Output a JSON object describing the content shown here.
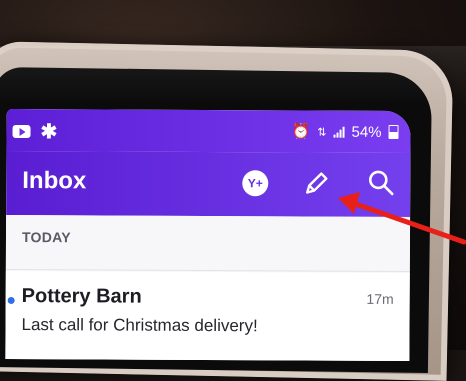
{
  "status_bar": {
    "battery": "54%",
    "left_icons": [
      "youtube-icon",
      "asterisk-icon"
    ],
    "right_icons": [
      "alarm-icon",
      "data-transfer-icon",
      "signal-icon",
      "battery-icon"
    ]
  },
  "app_bar": {
    "title": "Inbox",
    "yplus_label": "Y+",
    "icons": [
      "yahoo-plus-icon",
      "compose-pencil-icon",
      "search-icon"
    ]
  },
  "section": {
    "header": "TODAY"
  },
  "email": {
    "sender": "Pottery Barn",
    "time": "17m",
    "subject": "Last call for Christmas delivery!",
    "unread": true
  },
  "colors": {
    "app_purple": "#6a2fe0",
    "annotation_arrow": "#e8201a",
    "unread_dot": "#2f6fe6"
  }
}
